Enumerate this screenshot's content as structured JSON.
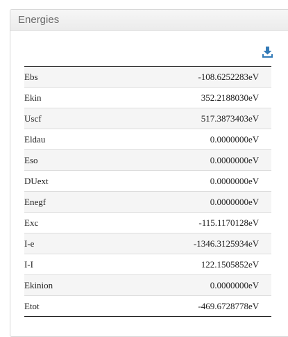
{
  "panel": {
    "title": "Energies",
    "download_icon": "download-icon",
    "accent_color": "#337ab7"
  },
  "energies": [
    {
      "label": "Ebs",
      "value": "-108.6252283",
      "unit": "eV"
    },
    {
      "label": "Ekin",
      "value": "352.2188030",
      "unit": "eV"
    },
    {
      "label": "Uscf",
      "value": "517.3873403",
      "unit": "eV"
    },
    {
      "label": "Eldau",
      "value": "0.0000000",
      "unit": "eV"
    },
    {
      "label": "Eso",
      "value": "0.0000000",
      "unit": "eV"
    },
    {
      "label": "DUext",
      "value": "0.0000000",
      "unit": "eV"
    },
    {
      "label": "Enegf",
      "value": "0.0000000",
      "unit": "eV"
    },
    {
      "label": "Exc",
      "value": "-115.1170128",
      "unit": "eV"
    },
    {
      "label": "I-e",
      "value": "-1346.3125934",
      "unit": "eV"
    },
    {
      "label": "I-I",
      "value": "122.1505852",
      "unit": "eV"
    },
    {
      "label": "Ekinion",
      "value": "0.0000000",
      "unit": "eV"
    },
    {
      "label": "Etot",
      "value": "-469.6728778",
      "unit": "eV"
    }
  ]
}
